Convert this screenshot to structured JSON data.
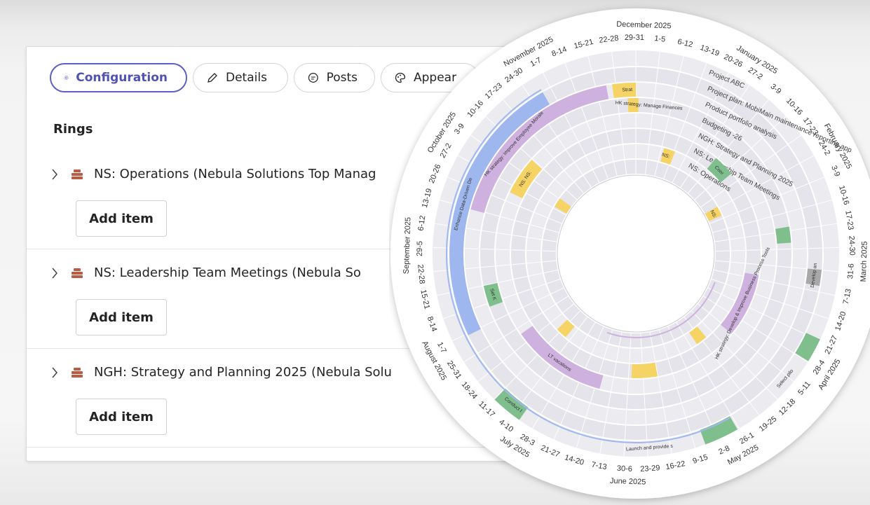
{
  "tabs": [
    {
      "label": "Configuration",
      "icon": "gear-icon",
      "active": true
    },
    {
      "label": "Details",
      "icon": "pencil-icon",
      "active": false
    },
    {
      "label": "Posts",
      "icon": "chat-icon",
      "active": false
    },
    {
      "label": "Appear",
      "icon": "palette-icon",
      "active": false
    }
  ],
  "rings_heading": "Rings",
  "rings": [
    {
      "name": "NS: Operations (Nebula Solutions Top Manag",
      "add_label": "Add item"
    },
    {
      "name": "NS: Leadership Team Meetings (Nebula So",
      "add_label": "Add item"
    },
    {
      "name": "NGH: Strategy and Planning 2025 (Nebula Solu",
      "add_label": "Add item"
    }
  ],
  "wheel": {
    "month_labels": [
      "December 2025",
      "January 2025",
      "February 2025",
      "March 2025",
      "April 2025",
      "May 2025",
      "June 2025",
      "July 2025",
      "August 2025",
      "September 2025",
      "October 2025",
      "November 2025"
    ],
    "week_labels": [
      "1-5",
      "6-12",
      "13-19",
      "20-26",
      "27-2",
      "3-9",
      "10-16",
      "17-23",
      "24-2",
      "3-9",
      "10-16",
      "17-23",
      "24-30",
      "31-6",
      "7-13",
      "14-20",
      "21-27",
      "28-4",
      "5-11",
      "12-18",
      "19-25",
      "26-1",
      "2-8",
      "9-15",
      "16-22",
      "23-29",
      "30-6",
      "7-13",
      "14-20",
      "21-27",
      "28-3",
      "4-10",
      "11-17",
      "18-24",
      "25-31",
      "1-7",
      "8-14",
      "15-21",
      "22-28",
      "29-5",
      "6-12",
      "13-19",
      "20-26",
      "27-2",
      "3-9",
      "10-16",
      "17-23",
      "24-30",
      "1-7",
      "8-14",
      "15-21",
      "22-28",
      "29-31"
    ],
    "ring_labels": [
      "Project ABC",
      "Project plan: MobiMain maintenance reporting app",
      "Product portfolio analysis",
      "Budgeting -26",
      "NGH: Strategy and Planning 2025",
      "NS: Leadership Team Meetings",
      "NS: Operations"
    ],
    "item_labels": [
      "Strat",
      "HK strategy: Manage Finances",
      "HK strategy: Improve Employee Morale",
      "Enhance Data-Driven De",
      "NS: NS:",
      "NS:",
      "NS:",
      "NS:",
      "NS:",
      "NS: Lead",
      "LT vacations",
      "HK strategy: Develop & Improve Business Process Tools",
      "Set K",
      "Conduct I",
      "Launch and provide s",
      "Select pilo",
      "Develop an",
      "Define ke Evaluate and refine",
      "Coor",
      "Ope",
      "Ope",
      "Ope",
      "Ope",
      "Ope",
      "Ope",
      "Ope"
    ],
    "colors": {
      "purple": "#cfb1df",
      "yellow": "#f6d365",
      "green": "#7fbf8e",
      "blue": "#9eb8ef",
      "gray": "#a8a8a8",
      "ring_bg": "#ebebf0",
      "ring_alt": "#e4e4ea"
    }
  }
}
